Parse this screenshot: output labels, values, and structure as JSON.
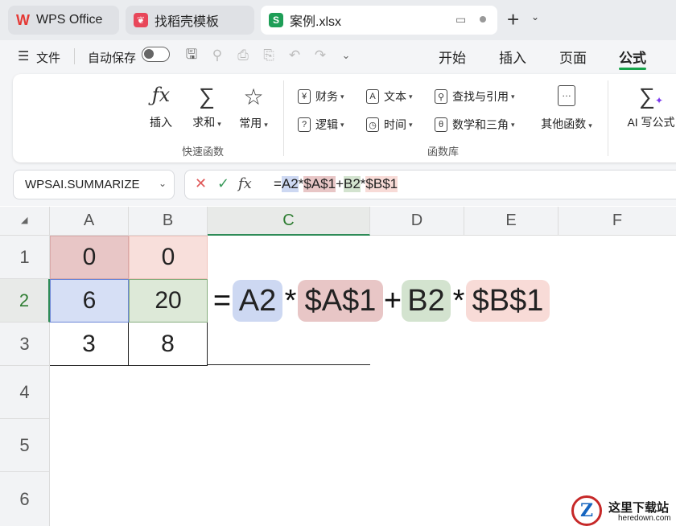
{
  "tabs": [
    {
      "label": "WPS Office",
      "icon": "wps-logo-icon"
    },
    {
      "label": "找稻壳模板",
      "icon": "docer-icon"
    },
    {
      "label": "案例.xlsx",
      "icon": "spreadsheet-icon"
    }
  ],
  "menu": {
    "file_label": "文件",
    "autosave_label": "自动保存",
    "ribbon_tabs": [
      "开始",
      "插入",
      "页面",
      "公式"
    ],
    "active_tab": "公式"
  },
  "ribbon": {
    "quick_functions": {
      "group_label": "快速函数",
      "buttons": [
        {
          "label": "插入",
          "icon": "fx-icon"
        },
        {
          "label": "求和",
          "icon": "sigma-icon"
        },
        {
          "label": "常用",
          "icon": "star-icon"
        }
      ]
    },
    "function_library": {
      "group_label": "函数库",
      "row1": [
        "财务",
        "文本",
        "查找与引用"
      ],
      "row2": [
        "逻辑",
        "时间",
        "数学和三角"
      ],
      "other_label": "其他函数"
    },
    "ai_label": "AI 写公式"
  },
  "formula_bar": {
    "name_box": "WPSAI.SUMMARIZE",
    "fx_symbol": "fx",
    "formula_parts": [
      "=",
      "A2",
      "*",
      "$A$1",
      "+",
      "B2",
      "*",
      "$B$1"
    ]
  },
  "grid": {
    "columns": [
      "A",
      "B",
      "C",
      "D",
      "E",
      "F"
    ],
    "rows": [
      "1",
      "2",
      "3",
      "4",
      "5",
      "6"
    ],
    "cells": {
      "A1": "0",
      "B1": "0",
      "A2": "6",
      "B2": "20",
      "A3": "3",
      "B3": "8"
    }
  },
  "overlay_formula": [
    "=",
    "A2",
    "*",
    "$A$1",
    "+",
    "B2",
    "*",
    "$B$1"
  ],
  "colors": {
    "ref_a2": "#cdd8f2",
    "ref_a1": "#e8c6c6",
    "ref_b2": "#d3e3cf",
    "ref_b1": "#f8dbd7",
    "active_tab": "#16a34a"
  },
  "watermark": {
    "text": "这里下载站",
    "sub": "heredown.com"
  }
}
